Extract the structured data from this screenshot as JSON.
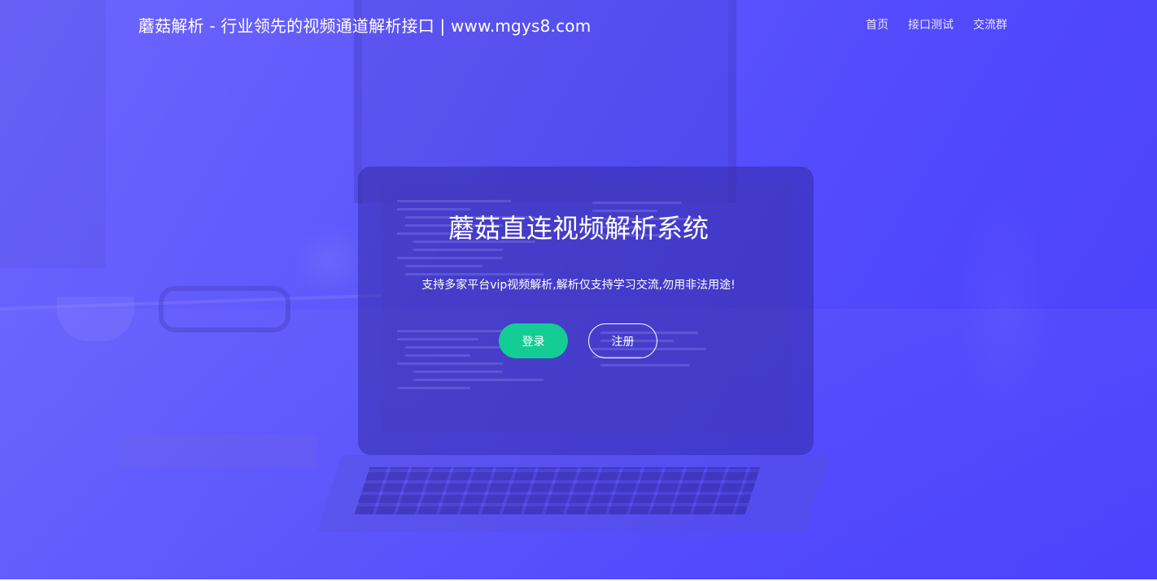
{
  "header": {
    "site_title": "蘑菇解析 - 行业领先的视频通道解析接口 | www.mgys8.com",
    "nav": [
      {
        "label": "首页"
      },
      {
        "label": "接口测试"
      },
      {
        "label": "交流群"
      }
    ]
  },
  "hero": {
    "title": "蘑菇直连视频解析系统",
    "subtitle": "支持多家平台vip视频解析,解析仅支持学习交流,勿用非法用途!",
    "login_label": "登录",
    "register_label": "注册"
  },
  "colors": {
    "background_gradient_start": "#6e66ff",
    "background_gradient_end": "#4a40fd",
    "login_button": "#13cd95",
    "text": "#ffffff"
  }
}
